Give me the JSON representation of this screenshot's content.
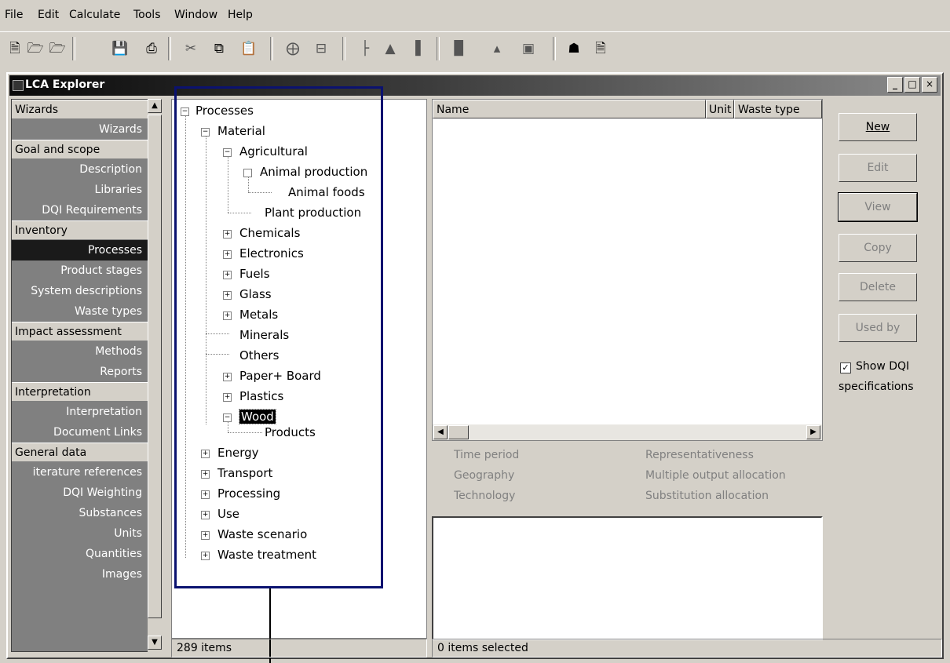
{
  "menu": [
    "File",
    "Edit",
    "Calculate",
    "Tools",
    "Window",
    "Help"
  ],
  "toolbar_icons": [
    "new-file-icon",
    "open-icon",
    "open-alt-icon",
    "save-icon",
    "print-icon",
    "cut-icon",
    "copy-icon",
    "paste-icon",
    "add-row-icon",
    "remove-row-icon",
    "tree-icon",
    "network-icon",
    "bars-icon",
    "analyze-icon",
    "chart-icon",
    "image-icon",
    "home-icon",
    "clipboard-icon"
  ],
  "window": {
    "title": "LCA Explorer",
    "min": "_",
    "max": "□",
    "close": "×"
  },
  "sidebar": {
    "wizards_category": "Wizards",
    "wizards_item": "Wizards",
    "goal_category": "Goal and scope",
    "goal_items": [
      "Description",
      "Libraries",
      "DQI Requirements"
    ],
    "inventory_category": "Inventory",
    "inventory_items": [
      "Processes",
      "Product stages",
      "System descriptions",
      "Waste types"
    ],
    "impact_category": "Impact assessment",
    "impact_items": [
      "Methods",
      "Reports"
    ],
    "interp_category": "Interpretation",
    "interp_items": [
      "Interpretation",
      "Document Links"
    ],
    "general_category": "General data",
    "general_items": [
      "iterature references",
      "DQI Weighting",
      "Substances",
      "Units",
      "Quantities",
      "Images"
    ]
  },
  "tree": {
    "root": "Processes",
    "material": "Material",
    "agricultural": "Agricultural",
    "animal_production": "Animal production",
    "animal_foods": "Animal foods",
    "plant_production": "Plant production",
    "chemicals": "Chemicals",
    "electronics": "Electronics",
    "fuels": "Fuels",
    "glass": "Glass",
    "metals": "Metals",
    "minerals": "Minerals",
    "others": "Others",
    "paper": "Paper+ Board",
    "plastics": "Plastics",
    "wood": "Wood",
    "products": "Products",
    "energy": "Energy",
    "transport": "Transport",
    "processing": "Processing",
    "use": "Use",
    "waste_scenario": "Waste scenario",
    "waste_treatment": "Waste treatment"
  },
  "list": {
    "col_name": "Name",
    "col_unit": "Unit",
    "col_waste": "Waste type"
  },
  "dqi": {
    "time_period": "Time period",
    "geography": "Geography",
    "technology": "Technology",
    "representativeness": "Representativeness",
    "multiple_output": "Multiple output allocation",
    "substitution": "Substitution allocation"
  },
  "buttons": {
    "new": "New",
    "edit": "Edit",
    "view": "View",
    "copy": "Copy",
    "delete": "Delete",
    "used_by": "Used by"
  },
  "show_dqi": {
    "checked": true,
    "line1": "Show DQI",
    "line2": "specifications"
  },
  "status": {
    "left": "289 items",
    "right": "0 items selected"
  }
}
